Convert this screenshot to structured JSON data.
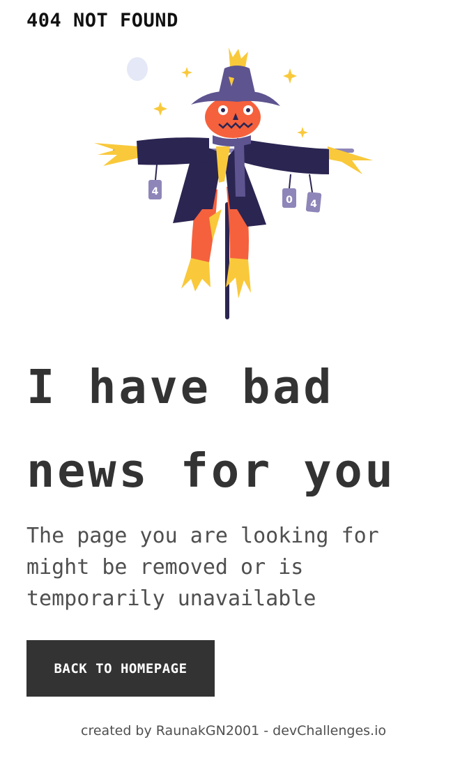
{
  "header": {
    "title": "404 NOT FOUND"
  },
  "illustration": {
    "icon": "scarecrow-illustration",
    "can_labels": [
      "4",
      "0",
      "4"
    ]
  },
  "main": {
    "headline": "I have bad news for you",
    "message": "The page you are looking for might be removed or is temporarily unavailable",
    "button_label": "BACK TO HOMEPAGE"
  },
  "footer": {
    "text": "created by RaunakGN2001 - devChallenges.io"
  },
  "colors": {
    "text_dark": "#333333",
    "text_muted": "#4f4f4f",
    "button_bg": "#333333",
    "button_text": "#ffffff",
    "hat": "#5e5490",
    "coat": "#2b2552",
    "orange": "#f5613d",
    "straw": "#f9c93b"
  }
}
